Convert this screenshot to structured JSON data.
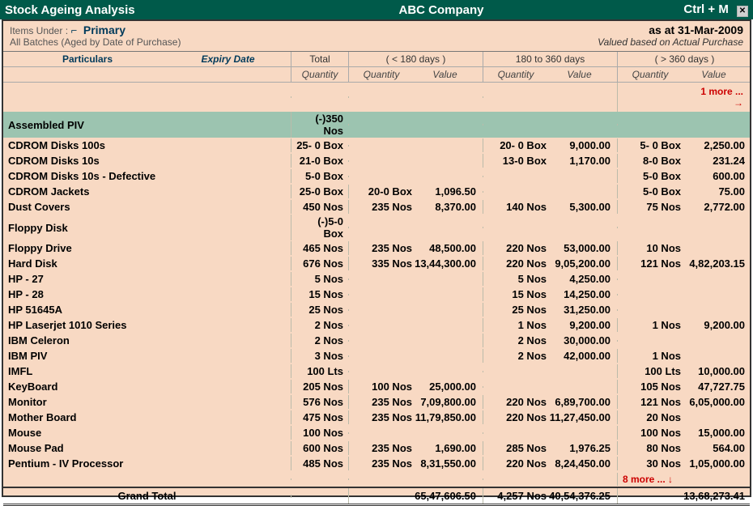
{
  "titlebar": {
    "left": "Stock Ageing Analysis",
    "center": "ABC Company",
    "shortcut": "Ctrl + M"
  },
  "header": {
    "items_under_label": "Items Under :",
    "items_under_value": "Primary",
    "glyph": "⌐",
    "subtitle": "All Batches (Aged by Date of Purchase)",
    "as_at": "as at 31-Mar-2009",
    "valued": "Valued based on Actual Purchase"
  },
  "columns": {
    "particulars": "Particulars",
    "expiry_date": "Expiry Date",
    "total": "Total",
    "b1": "( < 180 days )",
    "b2": "180 to 360 days",
    "b3": "( > 360 days )",
    "quantity": "Quantity",
    "value": "Value"
  },
  "more_top": "1 more ... →",
  "more_bottom": "8 more ... ↓",
  "rows": [
    {
      "name": "Assembled PIV",
      "total": "(-)350 Nos",
      "heading": true
    },
    {
      "name": "CDROM Disks 100s",
      "total": "25- 0 Box",
      "b2q": "20- 0 Box",
      "b2v": "9,000.00",
      "b3q": "5- 0 Box",
      "b3v": "2,250.00"
    },
    {
      "name": "CDROM Disks 10s",
      "total": "21-0 Box",
      "b2q": "13-0 Box",
      "b2v": "1,170.00",
      "b3q": "8-0 Box",
      "b3v": "231.24"
    },
    {
      "name": "CDROM Disks 10s - Defective",
      "total": "5-0 Box",
      "b3q": "5-0 Box",
      "b3v": "600.00"
    },
    {
      "name": "CDROM Jackets",
      "total": "25-0 Box",
      "b1q": "20-0 Box",
      "b1v": "1,096.50",
      "b3q": "5-0 Box",
      "b3v": "75.00"
    },
    {
      "name": "Dust Covers",
      "total": "450 Nos",
      "b1q": "235 Nos",
      "b1v": "8,370.00",
      "b2q": "140 Nos",
      "b2v": "5,300.00",
      "b3q": "75 Nos",
      "b3v": "2,772.00"
    },
    {
      "name": "Floppy Disk",
      "total": "(-)5-0 Box"
    },
    {
      "name": "Floppy Drive",
      "total": "465 Nos",
      "b1q": "235 Nos",
      "b1v": "48,500.00",
      "b2q": "220 Nos",
      "b2v": "53,000.00",
      "b3q": "10 Nos"
    },
    {
      "name": "Hard Disk",
      "total": "676 Nos",
      "b1q": "335 Nos",
      "b1v": "13,44,300.00",
      "b2q": "220 Nos",
      "b2v": "9,05,200.00",
      "b3q": "121 Nos",
      "b3v": "4,82,203.15"
    },
    {
      "name": "HP - 27",
      "total": "5 Nos",
      "b2q": "5 Nos",
      "b2v": "4,250.00"
    },
    {
      "name": "HP - 28",
      "total": "15 Nos",
      "b2q": "15 Nos",
      "b2v": "14,250.00"
    },
    {
      "name": "HP 51645A",
      "total": "25 Nos",
      "b2q": "25 Nos",
      "b2v": "31,250.00"
    },
    {
      "name": "HP Laserjet 1010 Series",
      "total": "2 Nos",
      "b2q": "1 Nos",
      "b2v": "9,200.00",
      "b3q": "1 Nos",
      "b3v": "9,200.00"
    },
    {
      "name": "IBM Celeron",
      "total": "2 Nos",
      "b2q": "2 Nos",
      "b2v": "30,000.00"
    },
    {
      "name": "IBM PIV",
      "total": "3 Nos",
      "b2q": "2 Nos",
      "b2v": "42,000.00",
      "b3q": "1 Nos"
    },
    {
      "name": "IMFL",
      "total": "100 Lts",
      "b3q": "100 Lts",
      "b3v": "10,000.00"
    },
    {
      "name": "KeyBoard",
      "total": "205 Nos",
      "b1q": "100 Nos",
      "b1v": "25,000.00",
      "b3q": "105 Nos",
      "b3v": "47,727.75"
    },
    {
      "name": "Monitor",
      "total": "576 Nos",
      "b1q": "235 Nos",
      "b1v": "7,09,800.00",
      "b2q": "220 Nos",
      "b2v": "6,89,700.00",
      "b3q": "121 Nos",
      "b3v": "6,05,000.00"
    },
    {
      "name": "Mother Board",
      "total": "475 Nos",
      "b1q": "235 Nos",
      "b1v": "11,79,850.00",
      "b2q": "220 Nos",
      "b2v": "11,27,450.00",
      "b3q": "20 Nos"
    },
    {
      "name": "Mouse",
      "total": "100 Nos",
      "b3q": "100 Nos",
      "b3v": "15,000.00"
    },
    {
      "name": "Mouse Pad",
      "total": "600 Nos",
      "b1q": "235 Nos",
      "b1v": "1,690.00",
      "b2q": "285 Nos",
      "b2v": "1,976.25",
      "b3q": "80 Nos",
      "b3v": "564.00"
    },
    {
      "name": "Pentium - IV Processor",
      "total": "485 Nos",
      "b1q": "235 Nos",
      "b1v": "8,31,550.00",
      "b2q": "220 Nos",
      "b2v": "8,24,450.00",
      "b3q": "30 Nos",
      "b3v": "1,05,000.00"
    }
  ],
  "grand_total": {
    "label": "Grand Total",
    "b1v": "65,47,606.50",
    "b2q": "4,257 Nos",
    "b2v": "40,54,376.25",
    "b3v": "13,68,273.41"
  }
}
